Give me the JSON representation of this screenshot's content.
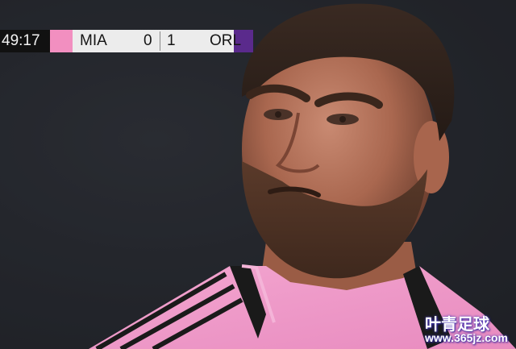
{
  "scorebug": {
    "clock": "49:17",
    "home": {
      "name": "MIA",
      "score": "0",
      "color": "#f28fc0"
    },
    "away": {
      "name": "ORL",
      "score": "1",
      "color": "#5a2a8c"
    }
  },
  "watermark": {
    "text": "叶青足球",
    "url": "www.365jz.com"
  }
}
